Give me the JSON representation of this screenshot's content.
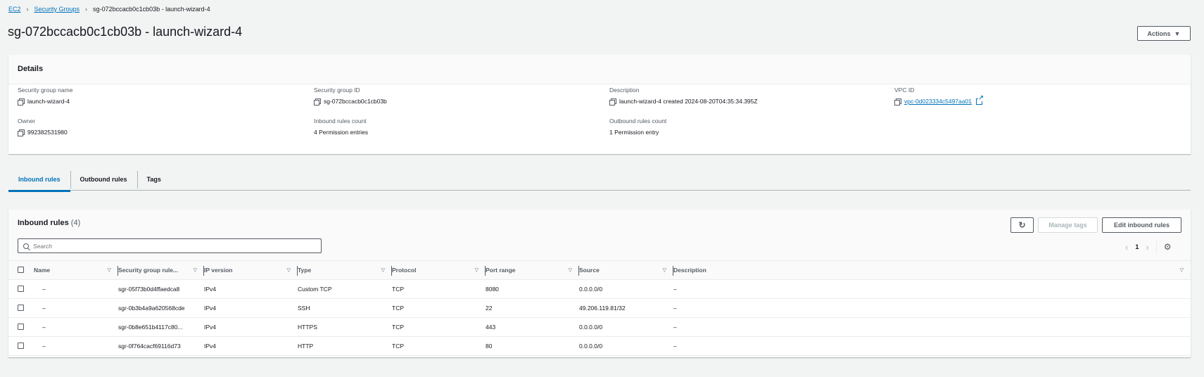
{
  "breadcrumb": {
    "ec2": "EC2",
    "security_groups": "Security Groups",
    "current": "sg-072bccacb0c1cb03b - launch-wizard-4"
  },
  "page": {
    "title": "sg-072bccacb0c1cb03b - launch-wizard-4",
    "actions_label": "Actions"
  },
  "details": {
    "title": "Details",
    "sg_name_label": "Security group name",
    "sg_name": "launch-wizard-4",
    "sg_id_label": "Security group ID",
    "sg_id": "sg-072bccacb0c1cb03b",
    "desc_label": "Description",
    "desc": "launch-wizard-4 created 2024-08-20T04:35:34.395Z",
    "vpc_label": "VPC ID",
    "vpc": "vpc-0d023334c5497aa01",
    "owner_label": "Owner",
    "owner": "992382531980",
    "inbound_count_label": "Inbound rules count",
    "inbound_count": "4 Permission entries",
    "outbound_count_label": "Outbound rules count",
    "outbound_count": "1 Permission entry"
  },
  "tabs": [
    "Inbound rules",
    "Outbound rules",
    "Tags"
  ],
  "rules": {
    "title": "Inbound rules",
    "count": "(4)",
    "manage_tags": "Manage tags",
    "edit": "Edit inbound rules",
    "search_placeholder": "Search",
    "page": "1",
    "columns": [
      "Name",
      "Security group rule...",
      "IP version",
      "Type",
      "Protocol",
      "Port range",
      "Source",
      "Description"
    ],
    "rows": [
      [
        "–",
        "sgr-05f73b0d4ffaedca8",
        "IPv4",
        "Custom TCP",
        "TCP",
        "8080",
        "0.0.0.0/0",
        "–"
      ],
      [
        "–",
        "sgr-0b3b4a9a620568cde",
        "IPv4",
        "SSH",
        "TCP",
        "22",
        "49.206.119.81/32",
        "–"
      ],
      [
        "–",
        "sgr-0b8e651b4117c80...",
        "IPv4",
        "HTTPS",
        "TCP",
        "443",
        "0.0.0.0/0",
        "–"
      ],
      [
        "–",
        "sgr-0f764cacf69116d73",
        "IPv4",
        "HTTP",
        "TCP",
        "80",
        "0.0.0.0/0",
        "–"
      ]
    ]
  },
  "colors": {
    "link": "#0073bb",
    "text": "#16191f",
    "muted": "#545b64"
  },
  "icons": [
    "copy-icon",
    "external-link-icon",
    "refresh-icon",
    "search-icon",
    "chevron-left-icon",
    "chevron-right-icon",
    "settings-icon",
    "caret-down-icon"
  ]
}
